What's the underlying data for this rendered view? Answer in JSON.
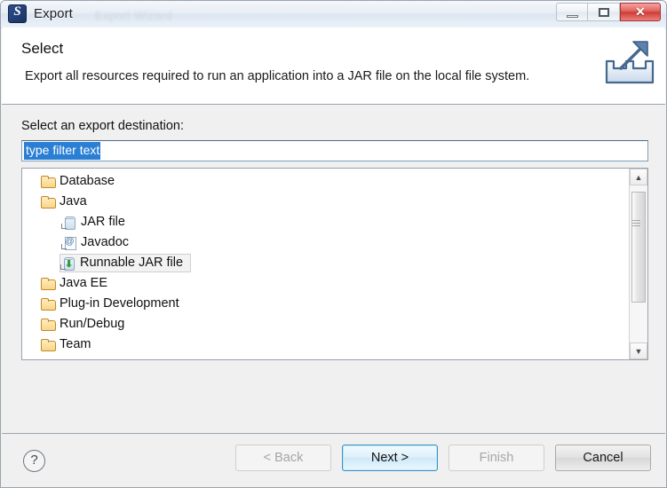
{
  "window": {
    "title": "Export",
    "ghost_title": "Export Wizard",
    "app_icon": "eclipse-icon",
    "controls": {
      "minimize": "minimize-icon",
      "maximize": "maximize-icon",
      "close": "✕"
    }
  },
  "header": {
    "title": "Select",
    "description": "Export all resources required to run an application into a JAR file on the local file system.",
    "banner_icon": "export-banner-icon"
  },
  "body": {
    "field_label": "Select an export destination:",
    "filter": {
      "value": "type filter text",
      "placeholder": "type filter text",
      "selected": true
    },
    "tree": {
      "items": [
        {
          "label": "Database",
          "icon": "folder-icon",
          "indent": 0,
          "selected": false
        },
        {
          "label": "Java",
          "icon": "folder-icon",
          "indent": 0,
          "selected": false
        },
        {
          "label": "JAR file",
          "icon": "jar-file-icon",
          "indent": 1,
          "selected": false
        },
        {
          "label": "Javadoc",
          "icon": "javadoc-icon",
          "indent": 1,
          "selected": false
        },
        {
          "label": "Runnable JAR file",
          "icon": "runnable-jar-icon",
          "indent": 1,
          "selected": true
        },
        {
          "label": "Java EE",
          "icon": "folder-icon",
          "indent": 0,
          "selected": false
        },
        {
          "label": "Plug-in Development",
          "icon": "folder-icon",
          "indent": 0,
          "selected": false
        },
        {
          "label": "Run/Debug",
          "icon": "folder-icon",
          "indent": 0,
          "selected": false
        },
        {
          "label": "Team",
          "icon": "folder-icon",
          "indent": 0,
          "selected": false
        }
      ],
      "scrollbar": {
        "up_arrow": "▲",
        "down_arrow": "▼"
      }
    }
  },
  "footer": {
    "help_label": "?",
    "buttons": [
      {
        "label": "< Back",
        "state": "disabled"
      },
      {
        "label": "Next >",
        "state": "default"
      },
      {
        "label": "Finish",
        "state": "disabled"
      },
      {
        "label": "Cancel",
        "state": "enabled"
      }
    ]
  },
  "colors": {
    "selection_blue": "#2a7fd4",
    "default_button_border": "#3c93c2",
    "folder_gold": "#f9d587",
    "close_red": "#cf3b36"
  }
}
